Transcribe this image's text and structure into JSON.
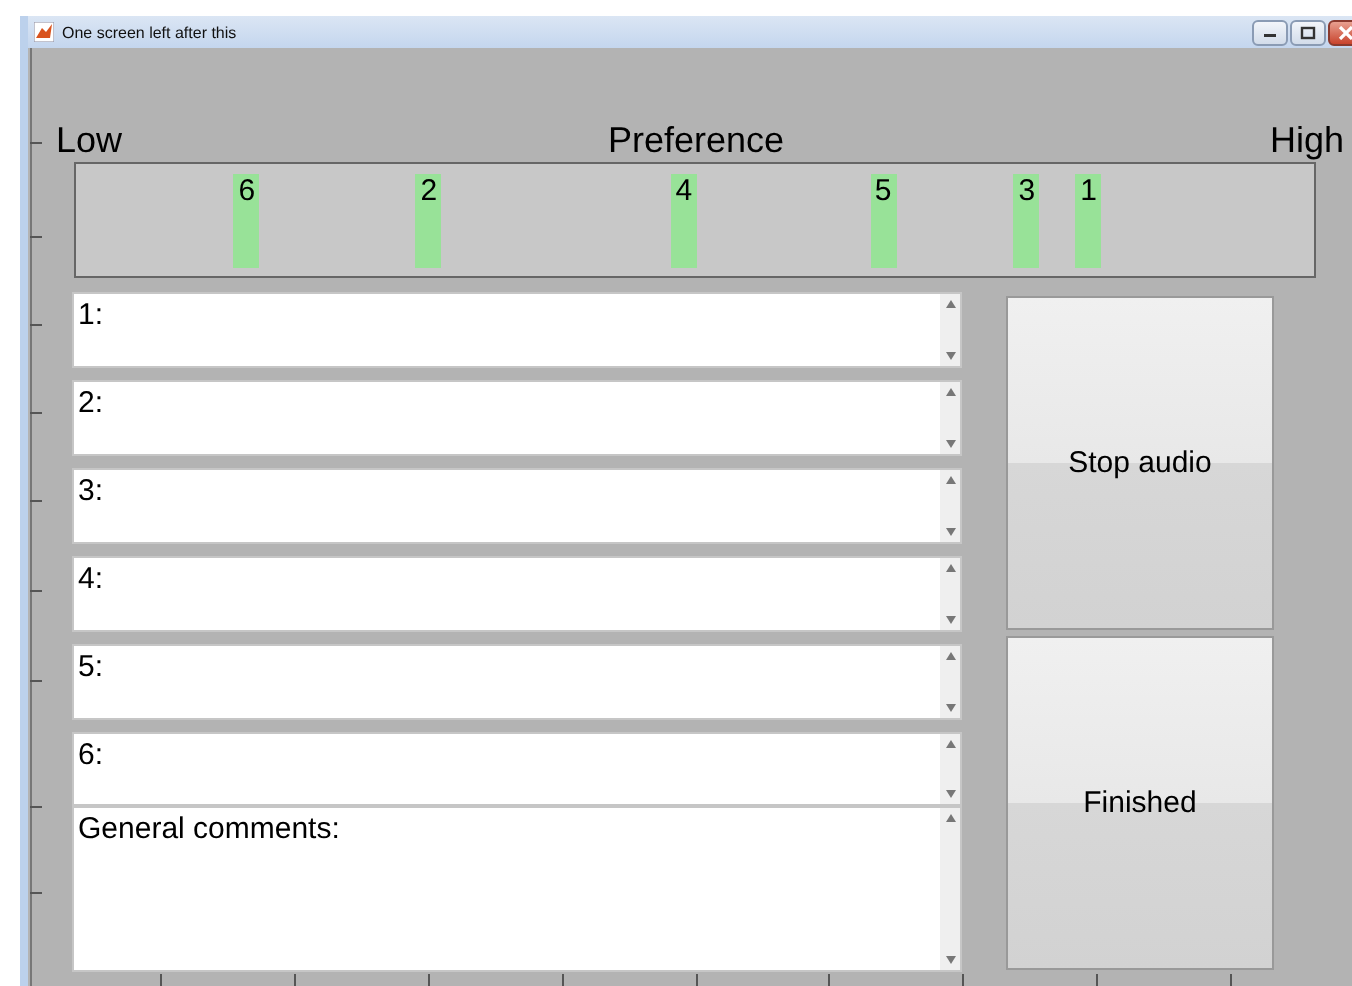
{
  "window": {
    "title": "One screen left after this"
  },
  "scale": {
    "low_label": "Low",
    "title": "Preference",
    "high_label": "High"
  },
  "markers": [
    {
      "label": "6",
      "level": 0.138
    },
    {
      "label": "2",
      "level": 0.285
    },
    {
      "label": "4",
      "level": 0.491
    },
    {
      "label": "5",
      "level": 0.652
    },
    {
      "label": "3",
      "level": 0.768
    },
    {
      "label": "1",
      "level": 0.818
    }
  ],
  "comment_fields": [
    {
      "kind": "rating",
      "value": "1:"
    },
    {
      "kind": "rating",
      "value": "2:"
    },
    {
      "kind": "rating",
      "value": "3:"
    },
    {
      "kind": "rating",
      "value": "4:"
    },
    {
      "kind": "rating",
      "value": "5:"
    },
    {
      "kind": "rating",
      "value": "6:"
    },
    {
      "kind": "general",
      "value": "General comments:"
    }
  ],
  "buttons": [
    "Stop audio",
    "Finished"
  ]
}
